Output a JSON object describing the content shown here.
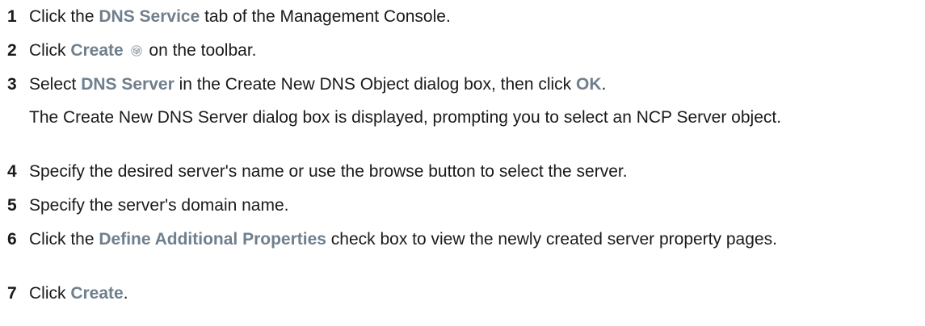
{
  "steps": [
    {
      "number": "1",
      "pre": "Click the ",
      "ui1": "DNS Service",
      "post": " tab of the Management Console."
    },
    {
      "number": "2",
      "pre": "Click ",
      "ui1": "Create",
      "icon": "create-object-icon",
      "post": " on the toolbar."
    },
    {
      "number": "3",
      "pre": "Select ",
      "ui1": "DNS Server",
      "mid": " in the Create New DNS Object dialog box, then click ",
      "ui2": "OK",
      "post": "."
    },
    {
      "number": "4",
      "text": "Specify the desired server's name or use the browse button to select the server."
    },
    {
      "number": "5",
      "text": "Specify the server's domain name."
    },
    {
      "number": "6",
      "pre": "Click the ",
      "ui1": "Define Additional Properties",
      "post": " check box to view the newly created server property pages."
    },
    {
      "number": "7",
      "pre": "Click ",
      "ui1": "Create",
      "post": "."
    }
  ],
  "note_after_step_3": "The Create New DNS Server dialog box is displayed, prompting you to select an NCP Server object.",
  "colors": {
    "ui_term": "#6f7f8c",
    "text": "#1a1a1a"
  }
}
